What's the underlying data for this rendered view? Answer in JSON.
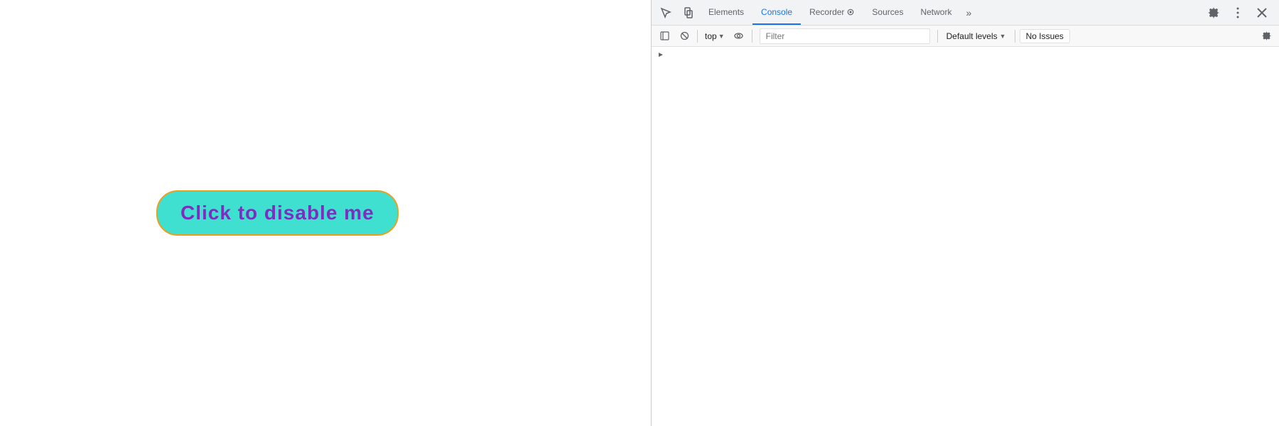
{
  "page": {
    "button_label": "Click to disable me"
  },
  "devtools": {
    "topbar": {
      "inspect_icon": "inspect",
      "device_icon": "device-toggle",
      "tabs": [
        {
          "id": "elements",
          "label": "Elements",
          "active": false
        },
        {
          "id": "console",
          "label": "Console",
          "active": true
        },
        {
          "id": "recorder",
          "label": "Recorder",
          "active": false
        },
        {
          "id": "sources",
          "label": "Sources",
          "active": false
        },
        {
          "id": "network",
          "label": "Network",
          "active": false
        }
      ],
      "more_tabs_icon": "more-tabs",
      "settings_icon": "settings",
      "more_options_icon": "more-options",
      "close_icon": "close"
    },
    "toolbar": {
      "clear_icon": "clear-console",
      "block_icon": "block",
      "context_label": "top",
      "eye_icon": "eye",
      "filter_placeholder": "Filter",
      "levels_label": "Default levels",
      "no_issues_label": "No Issues",
      "settings_icon": "gear"
    },
    "console_expand_icon": "chevron-right"
  }
}
